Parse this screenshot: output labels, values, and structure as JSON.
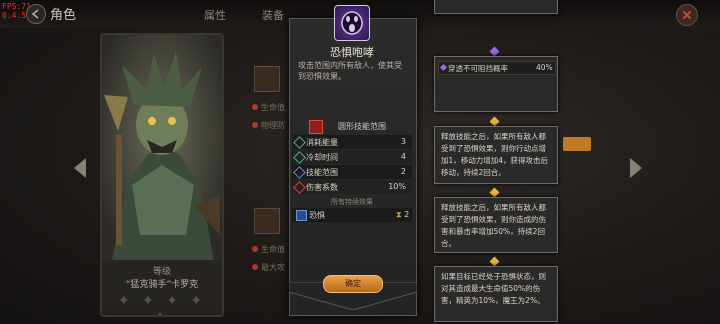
{
  "hud": {
    "fps": "FPS:71",
    "version": "0.4.5"
  },
  "header": {
    "title": "角色",
    "tabs": [
      {
        "label": "属性"
      },
      {
        "label": "装备"
      }
    ]
  },
  "hero": {
    "level_label": "等级",
    "name": "“猛克骑手”卡罗克",
    "stars": "✦ ✦ ✦ ✦ ✦"
  },
  "skill": {
    "name": "恐惧咆哮",
    "description": "攻击范围内所有敌人，使其受到恐惧效果。",
    "range_label": "圆形技能范围",
    "stats": [
      {
        "label": "消耗能量",
        "value": "3",
        "color": "#4fb28a"
      },
      {
        "label": "冷却时间",
        "value": "4",
        "color": "#4fb28a"
      },
      {
        "label": "技能范围",
        "value": "2",
        "color": "#5a8ad6"
      },
      {
        "label": "伤害系数",
        "value": "10%",
        "color": "#c9483a"
      }
    ],
    "effects_header": "所有持续效果",
    "effect": {
      "name": "恐惧",
      "count": "2"
    },
    "confirm_label": "确定",
    "icon": "scream-face-icon",
    "accent": "#6a3fa8"
  },
  "tooltips": [
    {
      "text": "穿透不可阻挡概率",
      "value": "40%"
    },
    {
      "text": "释放技能之后，如果所有敌人都受到了恐惧效果，则你行动点增加1，移动力增加4，获得攻击后移动，持续2回合。"
    },
    {
      "text": "释放技能之后，如果所有敌人都受到了恐惧效果，则你造成的伤害和暴击率增加50%，持续2回合。"
    },
    {
      "text": "如果目标已经处于恐惧状态，则对其造成最大生命值50%的伤害，精英为10%，魔王为2%。"
    }
  ],
  "background": {
    "labels": [
      "生命值",
      "物理防",
      "生命值",
      "最大攻"
    ]
  }
}
